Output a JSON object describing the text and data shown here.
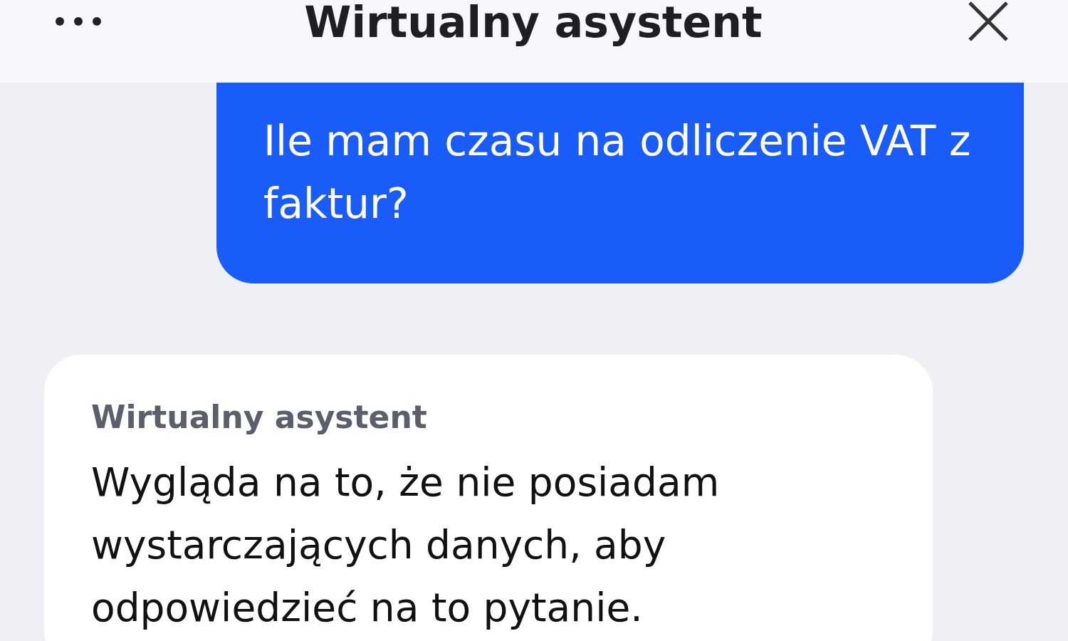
{
  "header": {
    "title": "Wirtualny asystent"
  },
  "messages": [
    {
      "kind": "user",
      "text": "Ile mam czasu na odliczenie VAT z faktur?"
    },
    {
      "kind": "assistant",
      "sender": "Wirtualny asystent",
      "text": "Wygląda na to, że nie posiadam wystarczających danych, aby odpowiedzieć na to pytanie."
    }
  ]
}
